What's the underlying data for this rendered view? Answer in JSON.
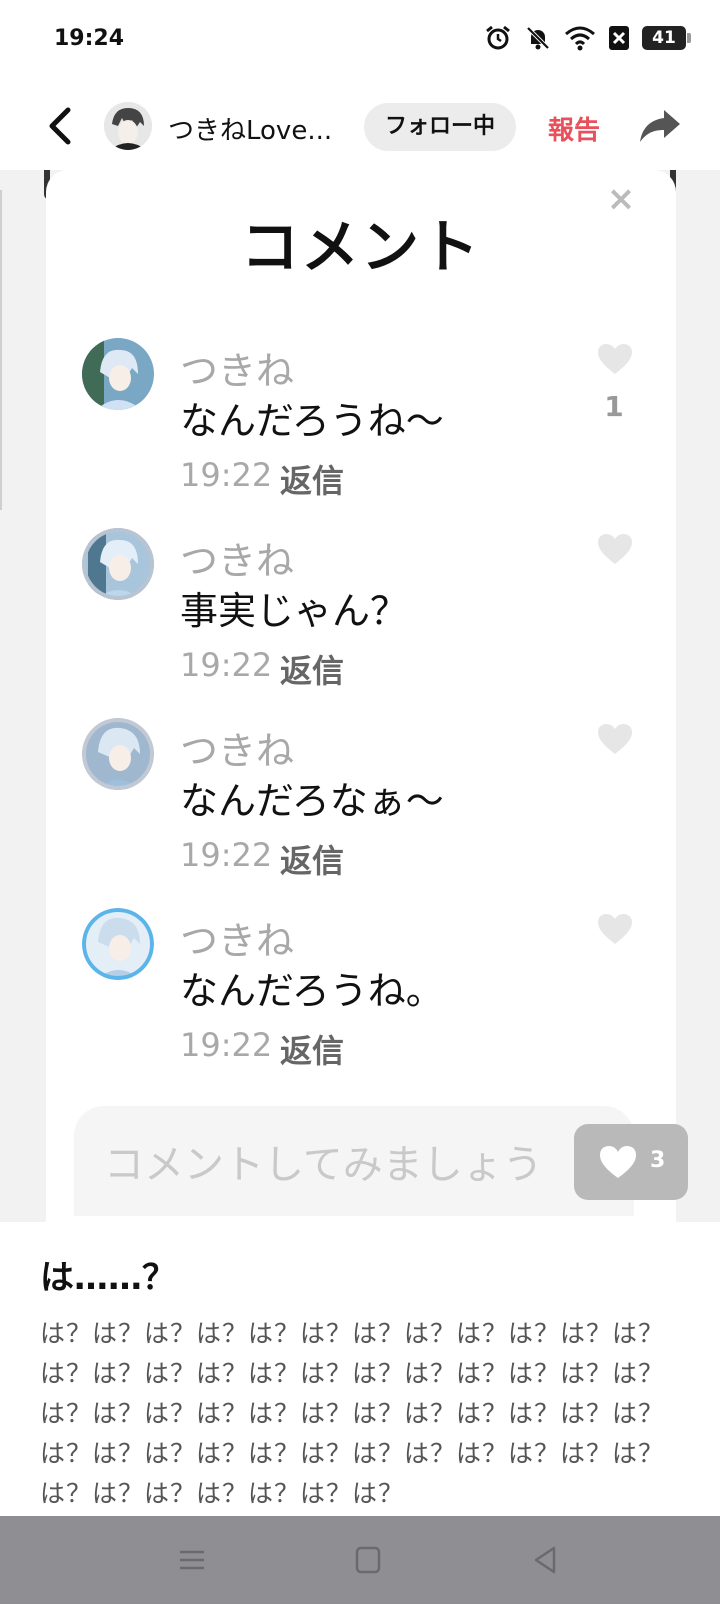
{
  "status_bar": {
    "time": "19:24",
    "battery": "41",
    "icons": [
      "alarm-icon",
      "bell-muted-icon",
      "wifi-icon",
      "sim-blocked-icon",
      "battery-icon"
    ]
  },
  "header": {
    "back_icon": "chevron-left-icon",
    "user_name": "つきねLove...",
    "follow_label": "フォロー中",
    "report_label": "報告",
    "share_icon": "share-arrow-icon"
  },
  "comments_modal": {
    "title": "コメント",
    "close_icon": "close-icon",
    "comments": [
      {
        "name": "つきね",
        "text": "なんだろうね〜",
        "time": "19:22",
        "reply_label": "返信",
        "likes": "1"
      },
      {
        "name": "つきね",
        "text": "事実じゃん？",
        "time": "19:22",
        "reply_label": "返信",
        "likes": ""
      },
      {
        "name": "つきね",
        "text": "なんだろなぁ〜",
        "time": "19:22",
        "reply_label": "返信",
        "likes": ""
      },
      {
        "name": "つきね",
        "text": "なんだろうね。",
        "time": "19:22",
        "reply_label": "返信",
        "likes": ""
      }
    ],
    "input_placeholder": "コメントしてみましょう"
  },
  "like_button": {
    "count": "3",
    "icon": "heart-icon"
  },
  "post": {
    "title": "は……？",
    "body": "は？は？は？は？は？は？は？は？は？は？は？は？は？は？は？は？は？は？は？は？は？は？は？は？は？は？は？は？は？は？は？は？は？は？は？は？は？は？は？は？は？は？は？は？は？は？は？は？は？は？は？は？は？は？は？"
  },
  "nav_bar": {
    "icons": [
      "menu-icon",
      "home-square-icon",
      "back-triangle-icon"
    ]
  },
  "colors": {
    "accent_red": "#e8505b",
    "nav_gray": "#8e8e93",
    "muted_text": "#a8a8a8"
  }
}
